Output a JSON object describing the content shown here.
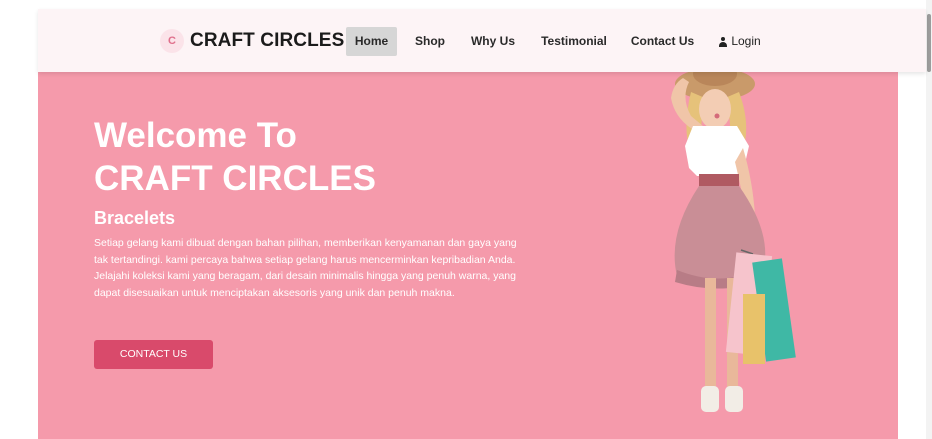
{
  "navbar": {
    "brand_logo_text": "C",
    "brand_name": "CRAFT CIRCLES",
    "items": [
      {
        "label": "Home"
      },
      {
        "label": "Shop"
      },
      {
        "label": "Why Us"
      },
      {
        "label": "Testimonial"
      },
      {
        "label": "Contact Us"
      }
    ],
    "login_label": "Login"
  },
  "hero": {
    "title_line1": "Welcome To",
    "title_line2": "CRAFT CIRCLES",
    "subtitle": "Bracelets",
    "description": "Setiap gelang kami dibuat dengan bahan pilihan, memberikan kenyamanan dan gaya yang tak tertandingi. kami percaya bahwa setiap gelang harus mencerminkan kepribadian Anda. Jelajahi koleksi kami yang beragam, dari desain minimalis hingga yang penuh warna, yang dapat disesuaikan untuk menciptakan aksesoris yang unik dan penuh makna.",
    "button_label": "CONTACT US"
  },
  "colors": {
    "hero_background": "#f59aab",
    "button": "#d94a6b",
    "navbar_background": "#fdf4f6",
    "active_nav": "#d6d6d6"
  },
  "icons": {
    "login": "user-icon"
  }
}
